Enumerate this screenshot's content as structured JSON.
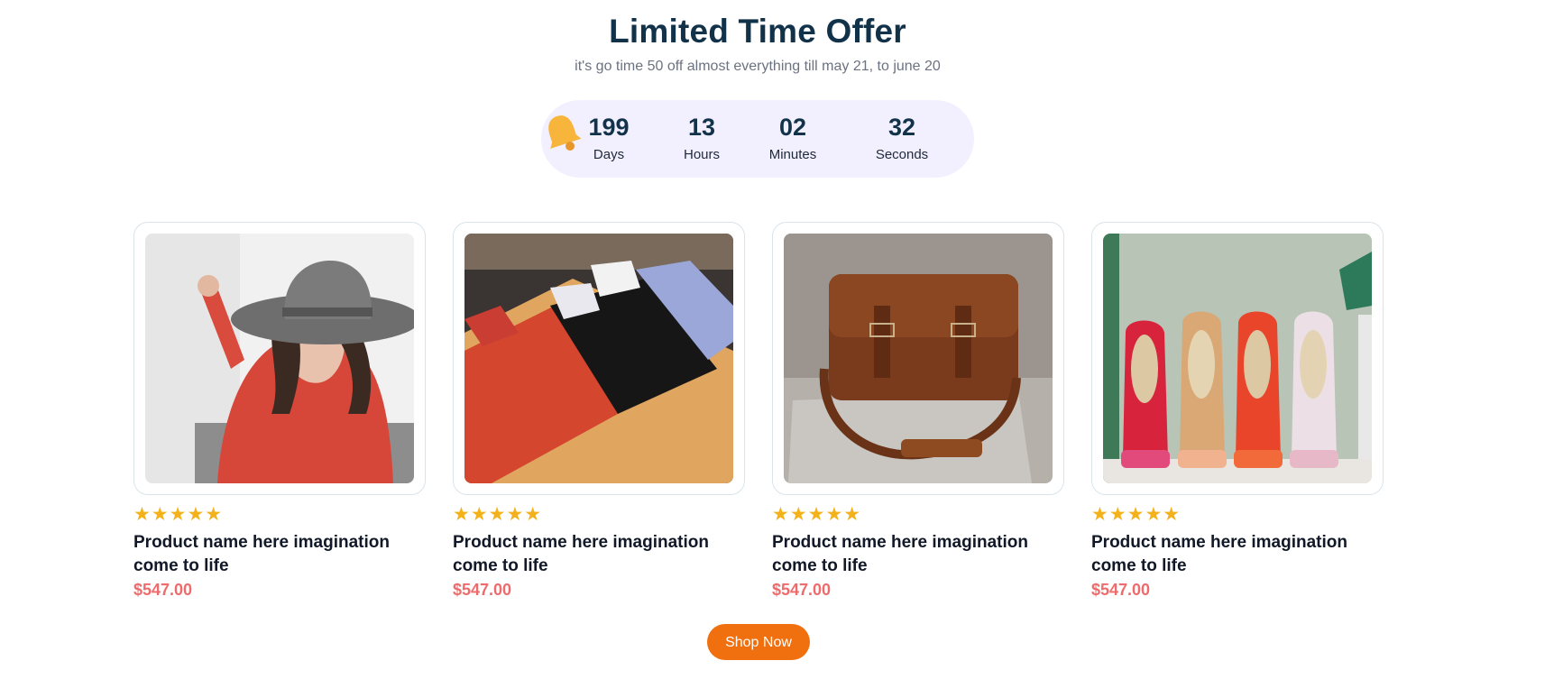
{
  "offer": {
    "title": "Limited Time Offer",
    "subtitle": "it's go time 50 off almost everything till may 21, to june 20"
  },
  "countdown": {
    "icon": "bell-icon",
    "units": [
      {
        "value": "199",
        "label": "Days"
      },
      {
        "value": "13",
        "label": "Hours"
      },
      {
        "value": "02",
        "label": "Minutes"
      },
      {
        "value": "32",
        "label": "Seconds"
      }
    ]
  },
  "products": [
    {
      "image": "woman-in-hat-photo",
      "stars": "★★★★★",
      "name": "Product name here imagination come to life",
      "price": "$547.00"
    },
    {
      "image": "folded-shirts-photo",
      "stars": "★★★★★",
      "name": "Product name here imagination come to life",
      "price": "$547.00"
    },
    {
      "image": "leather-bag-photo",
      "stars": "★★★★★",
      "name": "Product name here imagination come to life",
      "price": "$547.00"
    },
    {
      "image": "shoes-photo",
      "stars": "★★★★★",
      "name": "Product name here imagination come to life",
      "price": "$547.00"
    }
  ],
  "cta": {
    "label": "Shop Now"
  },
  "colors": {
    "accent": "#f0700f",
    "price": "#ef6b6b",
    "star": "#f3b21b",
    "heading": "#12324a",
    "timer_bg": "#f2f0ff"
  }
}
